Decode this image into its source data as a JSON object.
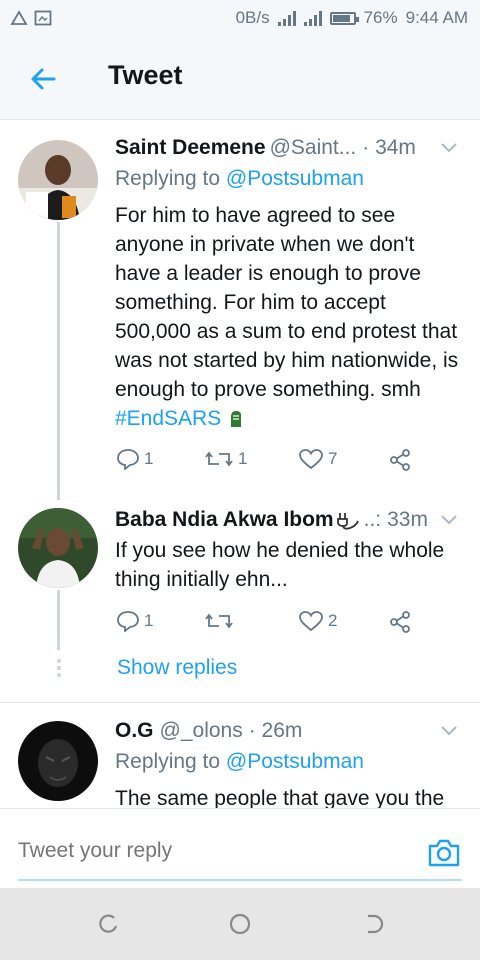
{
  "status_bar": {
    "speed": "0B/s",
    "battery": "76%",
    "time": "9:44 AM"
  },
  "header": {
    "title": "Tweet"
  },
  "tweets": [
    {
      "name": "Saint Deemene",
      "handle": "@Saint...",
      "time": "· 34m",
      "replying_label": "Replying to",
      "replying_to": "@Postsubman",
      "text_plain": "For him to have agreed to see anyone in private when we don't have a leader is enough to prove something. For him to accept 500,000 as a sum to end protest that was not started by him nationwide, is enough to prove something. smh",
      "hashtag": "#EndSARS",
      "reply_count": "1",
      "retweet_count": "1",
      "like_count": "7"
    },
    {
      "name": "Baba Ndia Akwa Ibom",
      "handle": "..:",
      "time": "33m",
      "text": "If you see how he denied the whole thing initially ehn...",
      "reply_count": "1",
      "retweet_count": "",
      "like_count": "2",
      "show_replies": "Show replies"
    },
    {
      "name": "O.G",
      "handle": "@_olons",
      "time": "· 26m",
      "replying_label": "Replying to",
      "replying_to": "@Postsubman",
      "text": "The same people that gave you the"
    }
  ],
  "reply_bar": {
    "placeholder": "Tweet your reply"
  },
  "icons": {
    "back": "back-arrow-icon",
    "chevron": "chevron-down-icon",
    "reply": "reply-icon",
    "retweet": "retweet-icon",
    "like": "heart-icon",
    "share": "share-icon",
    "camera": "camera-icon",
    "plug": "plug-emoji-icon",
    "fist": "raised-fist-emoji-icon"
  },
  "colors": {
    "accent": "#1da1f2",
    "secondary_text": "#657786",
    "divider": "#e1e8ed"
  }
}
